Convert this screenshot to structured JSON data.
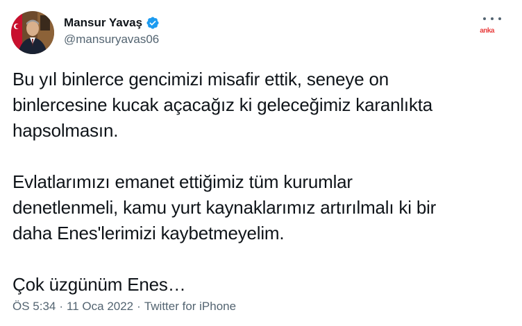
{
  "author": {
    "display_name": "Mansur Yavaş",
    "handle": "@mansuryavas06",
    "verified": true,
    "verified_icon": "verified-badge-icon",
    "avatar": "profile-photo"
  },
  "watermark": "anka",
  "more_icon": "more-options-icon",
  "tweet": {
    "text": "Bu yıl binlerce gencimizi misafir ettik, seneye on\nbinlercesine kucak açacağız ki geleceğimiz karanlıkta\nhapsolmasın.\n\nEvlatlarımızı emanet ettiğimiz tüm kurumlar\ndenetlenmeli, kamu yurt kaynaklarımız artırılmalı ki bir\ndaha Enes'lerimizi kaybetmeyelim.\n\nÇok üzgünüm Enes…"
  },
  "meta": {
    "time": "ÖS 5:34",
    "separator": "·",
    "date": "11 Oca 2022",
    "source": "Twitter for iPhone"
  },
  "colors": {
    "text": "#0f1419",
    "secondary": "#536471",
    "verified": "#1d9bf0",
    "watermark": "#e83e3e"
  }
}
